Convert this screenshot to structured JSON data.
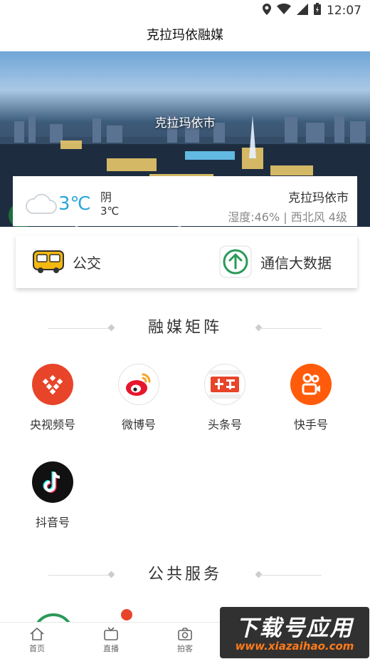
{
  "status_bar": {
    "time": "12:07"
  },
  "header": {
    "title": "克拉玛依融媒"
  },
  "banner": {
    "caption": "克拉玛依市"
  },
  "weather": {
    "temperature": "3℃",
    "condition": "阴",
    "temperature_small": "3℃",
    "city": "克拉玛依市",
    "detail": "湿度:46% | 西北风 4级",
    "icon": "cloud-icon"
  },
  "quick_links": [
    {
      "label": "公交",
      "icon": "bus-icon"
    },
    {
      "label": "通信大数据",
      "icon": "arrow-up-circle-icon"
    }
  ],
  "sections": {
    "media_matrix": "融媒矩阵",
    "public_service": "公共服务"
  },
  "media_items": [
    {
      "label": "央视频号",
      "icon": "cctv-video-icon",
      "color": "#e8442a"
    },
    {
      "label": "微博号",
      "icon": "weibo-icon",
      "color": "#e6162d"
    },
    {
      "label": "头条号",
      "icon": "toutiao-icon",
      "color": "#e8442a"
    },
    {
      "label": "快手号",
      "icon": "kuaishou-icon",
      "color": "#ff5b0a"
    },
    {
      "label": "抖音号",
      "icon": "douyin-icon",
      "color": "#111111"
    }
  ],
  "tabbar": [
    {
      "label": "首页",
      "icon": "home-icon"
    },
    {
      "label": "直播",
      "icon": "tv-icon"
    },
    {
      "label": "拍客",
      "icon": "camera-icon"
    }
  ],
  "watermark": {
    "title": "下载号应用",
    "url": "www.xiazaihao.com"
  }
}
